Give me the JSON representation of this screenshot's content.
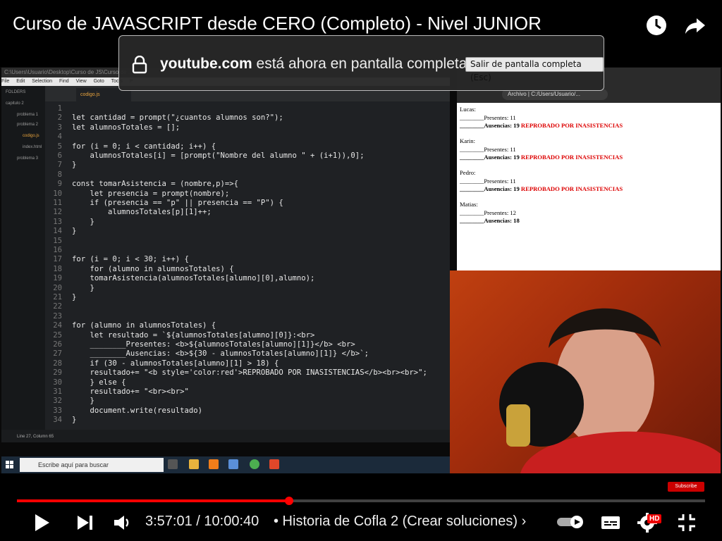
{
  "video": {
    "title": "Curso de JAVASCRIPT desde CERO (Completo) - Nivel JUNIOR"
  },
  "fullscreen_notice": {
    "domain": "youtube.com",
    "message": " está ahora en pantalla completa",
    "exit_button": "Salir de pantalla completa (Esc)"
  },
  "editor": {
    "titlebar": "C:\\Users\\Usuario\\Desktop\\Curso de JS\\Curso de ...",
    "menu": [
      "File",
      "Edit",
      "Selection",
      "Find",
      "View",
      "Goto",
      "Tools",
      "P"
    ],
    "sidebar": {
      "header": "FOLDERS",
      "items": [
        "capitulo 2",
        "problema 1",
        "problema 2",
        "codigo.js",
        "index.html",
        "problema 3"
      ]
    },
    "tab": "codigo.js",
    "line_numbers": [
      "1",
      "2",
      "3",
      "4",
      "5",
      "6",
      "7",
      "8",
      "9",
      "10",
      "11",
      "12",
      "13",
      "14",
      "15",
      "16",
      "17",
      "18",
      "19",
      "20",
      "21",
      "22",
      "23",
      "24",
      "25",
      "26",
      "27",
      "28",
      "29",
      "30",
      "31",
      "32",
      "33",
      "34"
    ],
    "status": "Line 27, Column 65"
  },
  "code_lines": [
    "",
    "let cantidad = prompt(\"¿cuantos alumnos son?\");",
    "let alumnosTotales = [];",
    "",
    "for (i = 0; i < cantidad; i++) {",
    "    alumnosTotales[i] = [prompt(\"Nombre del alumno \" + (i+1)),0];",
    "}",
    "",
    "const tomarAsistencia = (nombre,p)=>{",
    "    let presencia = prompt(nombre);",
    "    if (presencia == \"p\" || presencia == \"P\") {",
    "        alumnosTotales[p][1]++;",
    "    }",
    "}",
    "",
    "",
    "for (i = 0; i < 30; i++) {",
    "    for (alumno in alumnosTotales) {",
    "    tomarAsistencia(alumnosTotales[alumno][0],alumno);",
    "    }",
    "}",
    "",
    "",
    "for (alumno in alumnosTotales) {",
    "    let resultado = `${alumnosTotales[alumno][0]}:<br>",
    "    ________Presentes: <b>${alumnosTotales[alumno][1]}</b> <br>",
    "    ________Ausencias: <b>${30 - alumnosTotales[alumno][1]} </b>`;",
    "    if (30 - alumnosTotales[alumno][1] > 18) {",
    "    resultado+= \"<b style='color:red'>REPROBADO POR INASISTENCIAS</b><br><br>\";",
    "    } else {",
    "    resultado+= \"<br><br>\"",
    "    }",
    "    document.write(resultado)",
    "}"
  ],
  "taskbar": {
    "search_placeholder": "Escribe aquí para buscar"
  },
  "browser": {
    "address": "Archivo | C:/Users/Usuario/...",
    "rows": [
      {
        "name": "Lucas:",
        "presentes": "________Presentes: 11",
        "ausencias": "________Ausencias: 19",
        "status": "REPROBADO POR INASISTENCIAS"
      },
      {
        "name": "Karin:",
        "presentes": "________Presentes: 11",
        "ausencias": "________Ausencias: 19",
        "status": "REPROBADO POR INASISTENCIAS"
      },
      {
        "name": "Pedro:",
        "presentes": "________Presentes: 11",
        "ausencias": "________Ausencias: 19",
        "status": "REPROBADO POR INASISTENCIAS"
      },
      {
        "name": "Matias:",
        "presentes": "________Presentes: 12",
        "ausencias": "________Ausencias: 18",
        "status": ""
      }
    ]
  },
  "subscribe": "Subscribe",
  "player": {
    "current_time": "3:57:01",
    "duration": "10:00:40",
    "time_separator": " / ",
    "chapter": "• Historia de Cofla 2 (Crear soluciones)",
    "chapter_chevron": "›",
    "hd_badge": "HD",
    "progress_fraction": 0.395,
    "colors": {
      "played": "#ff0000",
      "accent": "#cc0000"
    }
  }
}
